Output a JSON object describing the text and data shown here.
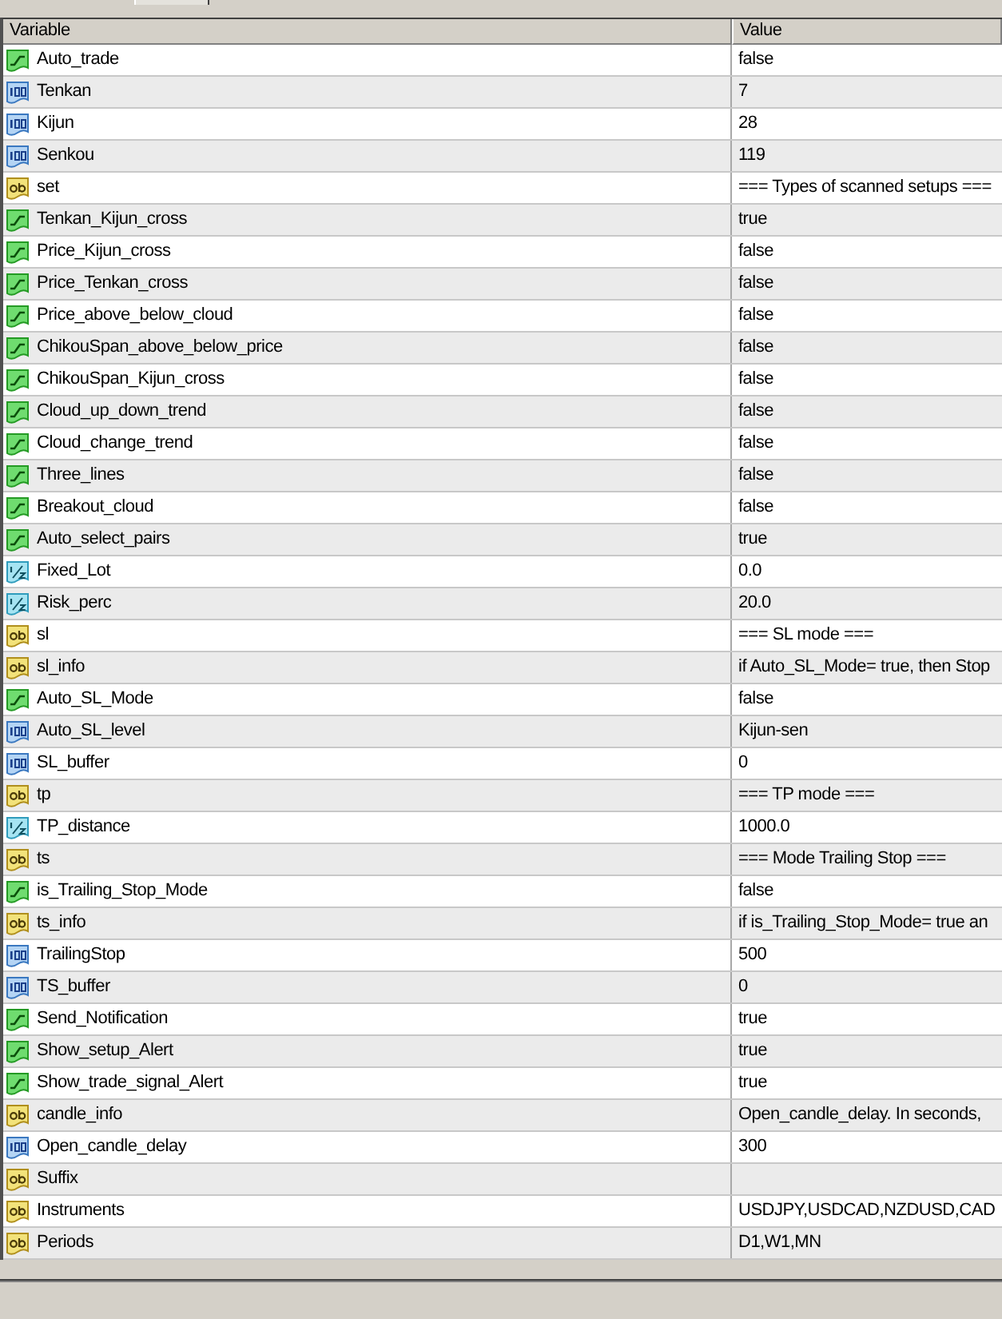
{
  "table": {
    "columns": [
      "Variable",
      "Value"
    ],
    "rows": [
      {
        "kind": "bool",
        "variable": "Auto_trade",
        "value": "false"
      },
      {
        "kind": "int",
        "variable": "Tenkan",
        "value": "7"
      },
      {
        "kind": "int",
        "variable": "Kijun",
        "value": "28"
      },
      {
        "kind": "int",
        "variable": "Senkou",
        "value": "119"
      },
      {
        "kind": "string",
        "variable": "set",
        "value": "=== Types of scanned setups ==="
      },
      {
        "kind": "bool",
        "variable": "Tenkan_Kijun_cross",
        "value": "true"
      },
      {
        "kind": "bool",
        "variable": "Price_Kijun_cross",
        "value": "false"
      },
      {
        "kind": "bool",
        "variable": "Price_Tenkan_cross",
        "value": "false"
      },
      {
        "kind": "bool",
        "variable": "Price_above_below_cloud",
        "value": "false"
      },
      {
        "kind": "bool",
        "variable": "ChikouSpan_above_below_price",
        "value": "false"
      },
      {
        "kind": "bool",
        "variable": "ChikouSpan_Kijun_cross",
        "value": "false"
      },
      {
        "kind": "bool",
        "variable": "Cloud_up_down_trend",
        "value": "false"
      },
      {
        "kind": "bool",
        "variable": "Cloud_change_trend",
        "value": "false"
      },
      {
        "kind": "bool",
        "variable": "Three_lines",
        "value": "false"
      },
      {
        "kind": "bool",
        "variable": "Breakout_cloud",
        "value": "false"
      },
      {
        "kind": "bool",
        "variable": "Auto_select_pairs",
        "value": "true"
      },
      {
        "kind": "double",
        "variable": "Fixed_Lot",
        "value": "0.0"
      },
      {
        "kind": "double",
        "variable": "Risk_perc",
        "value": "20.0"
      },
      {
        "kind": "string",
        "variable": "sl",
        "value": "=== SL mode ==="
      },
      {
        "kind": "string",
        "variable": "sl_info",
        "value": "if Auto_SL_Mode= true, then Stop"
      },
      {
        "kind": "bool",
        "variable": "Auto_SL_Mode",
        "value": "false"
      },
      {
        "kind": "int",
        "variable": "Auto_SL_level",
        "value": "Kijun-sen"
      },
      {
        "kind": "int",
        "variable": "SL_buffer",
        "value": "0"
      },
      {
        "kind": "string",
        "variable": "tp",
        "value": "=== TP mode ==="
      },
      {
        "kind": "double",
        "variable": "TP_distance",
        "value": "1000.0"
      },
      {
        "kind": "string",
        "variable": "ts",
        "value": "=== Mode Trailing Stop ==="
      },
      {
        "kind": "bool",
        "variable": "is_Trailing_Stop_Mode",
        "value": "false"
      },
      {
        "kind": "string",
        "variable": "ts_info",
        "value": "if is_Trailing_Stop_Mode= true an"
      },
      {
        "kind": "int",
        "variable": "TrailingStop",
        "value": "500"
      },
      {
        "kind": "int",
        "variable": "TS_buffer",
        "value": "0"
      },
      {
        "kind": "bool",
        "variable": "Send_Notification",
        "value": "true"
      },
      {
        "kind": "bool",
        "variable": "Show_setup_Alert",
        "value": "true"
      },
      {
        "kind": "bool",
        "variable": "Show_trade_signal_Alert",
        "value": "true"
      },
      {
        "kind": "string",
        "variable": "candle_info",
        "value": "Open_candle_delay. In seconds,"
      },
      {
        "kind": "int",
        "variable": "Open_candle_delay",
        "value": "300"
      },
      {
        "kind": "string",
        "variable": "Suffix"
      },
      {
        "kind": "string",
        "variable": "Instruments",
        "value": "USDJPY,USDCAD,NZDUSD,CAD"
      },
      {
        "kind": "string",
        "variable": "Periods",
        "value": "D1,W1,MN"
      }
    ]
  }
}
